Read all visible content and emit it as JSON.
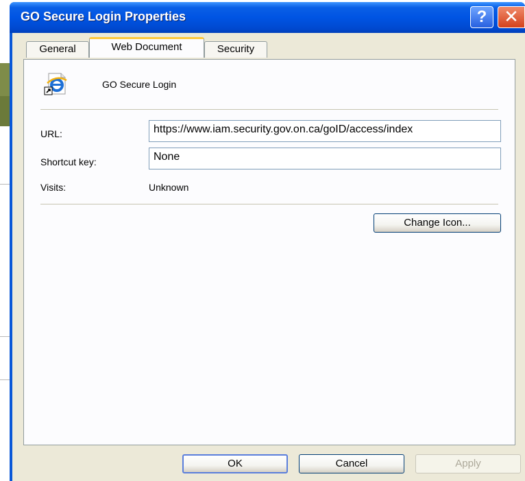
{
  "window": {
    "title": "GO Secure Login Properties",
    "help_glyph": "?",
    "close_glyph": "✕"
  },
  "tabs": [
    {
      "label": "General",
      "active": false
    },
    {
      "label": "Web Document",
      "active": true
    },
    {
      "label": "Security",
      "active": false
    }
  ],
  "document": {
    "icon": "internet-explorer-shortcut-icon",
    "name": "GO Secure Login"
  },
  "fields": {
    "url_label": "URL:",
    "url_value": "https://www.iam.security.gov.on.ca/goID/access/index",
    "shortcut_label": "Shortcut key:",
    "shortcut_value": "None",
    "visits_label": "Visits:",
    "visits_value": "Unknown"
  },
  "buttons": {
    "change_icon": "Change Icon...",
    "ok": "OK",
    "cancel": "Cancel",
    "apply": "Apply"
  },
  "colors": {
    "titlebar": "#0054e3",
    "dialog_face": "#ece9d8",
    "active_tab_highlight": "#ffc83c",
    "close_button": "#d4411c"
  }
}
